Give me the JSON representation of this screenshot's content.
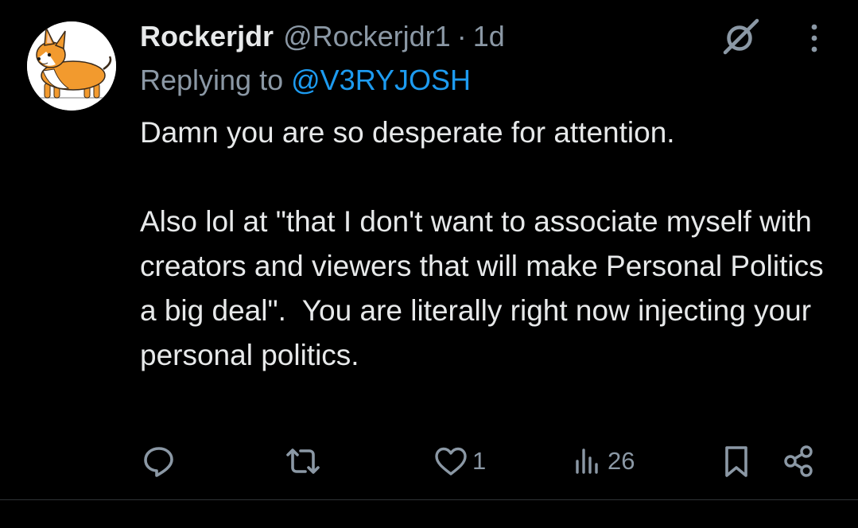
{
  "tweet": {
    "display_name": "Rockerjdr",
    "handle": "@Rockerjdr1",
    "separator": "·",
    "time": "1d",
    "replying_prefix": "Replying to ",
    "replying_to": "@V3RYJOSH",
    "paragraphs": [
      "Damn you are so desperate for attention.",
      "Also lol at \"that I don't want to associate myself with creators and viewers that will make Personal Politics a big deal\".  You are literally right now injecting your personal politics."
    ]
  },
  "actions": {
    "reply_icon": "reply-icon",
    "retweet_icon": "retweet-icon",
    "like_icon": "heart-icon",
    "like_count": "1",
    "views_icon": "views-icon",
    "views_count": "26",
    "bookmark_icon": "bookmark-icon",
    "share_icon": "share-icon"
  },
  "header_icons": {
    "grok": "grok-icon",
    "more": "more-icon"
  },
  "colors": {
    "background": "#000000",
    "text": "#e7e9ea",
    "muted": "#8b98a5",
    "link": "#1d9bf0",
    "divider": "#2f3336",
    "avatar_dog": "#f29a2e"
  }
}
